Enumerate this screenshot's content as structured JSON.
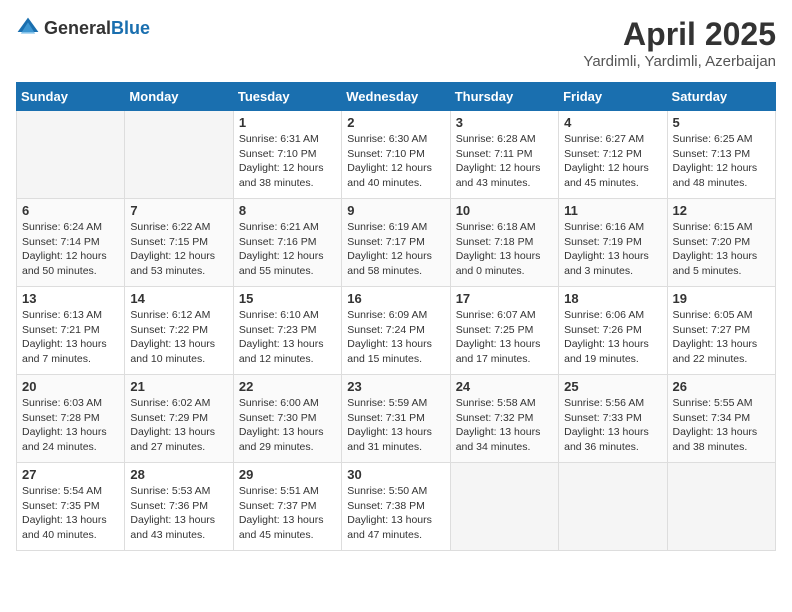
{
  "header": {
    "logo_general": "General",
    "logo_blue": "Blue",
    "month": "April 2025",
    "location": "Yardimli, Yardimli, Azerbaijan"
  },
  "days_of_week": [
    "Sunday",
    "Monday",
    "Tuesday",
    "Wednesday",
    "Thursday",
    "Friday",
    "Saturday"
  ],
  "weeks": [
    [
      {
        "day": "",
        "sunrise": "",
        "sunset": "",
        "daylight": ""
      },
      {
        "day": "",
        "sunrise": "",
        "sunset": "",
        "daylight": ""
      },
      {
        "day": "1",
        "sunrise": "Sunrise: 6:31 AM",
        "sunset": "Sunset: 7:10 PM",
        "daylight": "Daylight: 12 hours and 38 minutes."
      },
      {
        "day": "2",
        "sunrise": "Sunrise: 6:30 AM",
        "sunset": "Sunset: 7:10 PM",
        "daylight": "Daylight: 12 hours and 40 minutes."
      },
      {
        "day": "3",
        "sunrise": "Sunrise: 6:28 AM",
        "sunset": "Sunset: 7:11 PM",
        "daylight": "Daylight: 12 hours and 43 minutes."
      },
      {
        "day": "4",
        "sunrise": "Sunrise: 6:27 AM",
        "sunset": "Sunset: 7:12 PM",
        "daylight": "Daylight: 12 hours and 45 minutes."
      },
      {
        "day": "5",
        "sunrise": "Sunrise: 6:25 AM",
        "sunset": "Sunset: 7:13 PM",
        "daylight": "Daylight: 12 hours and 48 minutes."
      }
    ],
    [
      {
        "day": "6",
        "sunrise": "Sunrise: 6:24 AM",
        "sunset": "Sunset: 7:14 PM",
        "daylight": "Daylight: 12 hours and 50 minutes."
      },
      {
        "day": "7",
        "sunrise": "Sunrise: 6:22 AM",
        "sunset": "Sunset: 7:15 PM",
        "daylight": "Daylight: 12 hours and 53 minutes."
      },
      {
        "day": "8",
        "sunrise": "Sunrise: 6:21 AM",
        "sunset": "Sunset: 7:16 PM",
        "daylight": "Daylight: 12 hours and 55 minutes."
      },
      {
        "day": "9",
        "sunrise": "Sunrise: 6:19 AM",
        "sunset": "Sunset: 7:17 PM",
        "daylight": "Daylight: 12 hours and 58 minutes."
      },
      {
        "day": "10",
        "sunrise": "Sunrise: 6:18 AM",
        "sunset": "Sunset: 7:18 PM",
        "daylight": "Daylight: 13 hours and 0 minutes."
      },
      {
        "day": "11",
        "sunrise": "Sunrise: 6:16 AM",
        "sunset": "Sunset: 7:19 PM",
        "daylight": "Daylight: 13 hours and 3 minutes."
      },
      {
        "day": "12",
        "sunrise": "Sunrise: 6:15 AM",
        "sunset": "Sunset: 7:20 PM",
        "daylight": "Daylight: 13 hours and 5 minutes."
      }
    ],
    [
      {
        "day": "13",
        "sunrise": "Sunrise: 6:13 AM",
        "sunset": "Sunset: 7:21 PM",
        "daylight": "Daylight: 13 hours and 7 minutes."
      },
      {
        "day": "14",
        "sunrise": "Sunrise: 6:12 AM",
        "sunset": "Sunset: 7:22 PM",
        "daylight": "Daylight: 13 hours and 10 minutes."
      },
      {
        "day": "15",
        "sunrise": "Sunrise: 6:10 AM",
        "sunset": "Sunset: 7:23 PM",
        "daylight": "Daylight: 13 hours and 12 minutes."
      },
      {
        "day": "16",
        "sunrise": "Sunrise: 6:09 AM",
        "sunset": "Sunset: 7:24 PM",
        "daylight": "Daylight: 13 hours and 15 minutes."
      },
      {
        "day": "17",
        "sunrise": "Sunrise: 6:07 AM",
        "sunset": "Sunset: 7:25 PM",
        "daylight": "Daylight: 13 hours and 17 minutes."
      },
      {
        "day": "18",
        "sunrise": "Sunrise: 6:06 AM",
        "sunset": "Sunset: 7:26 PM",
        "daylight": "Daylight: 13 hours and 19 minutes."
      },
      {
        "day": "19",
        "sunrise": "Sunrise: 6:05 AM",
        "sunset": "Sunset: 7:27 PM",
        "daylight": "Daylight: 13 hours and 22 minutes."
      }
    ],
    [
      {
        "day": "20",
        "sunrise": "Sunrise: 6:03 AM",
        "sunset": "Sunset: 7:28 PM",
        "daylight": "Daylight: 13 hours and 24 minutes."
      },
      {
        "day": "21",
        "sunrise": "Sunrise: 6:02 AM",
        "sunset": "Sunset: 7:29 PM",
        "daylight": "Daylight: 13 hours and 27 minutes."
      },
      {
        "day": "22",
        "sunrise": "Sunrise: 6:00 AM",
        "sunset": "Sunset: 7:30 PM",
        "daylight": "Daylight: 13 hours and 29 minutes."
      },
      {
        "day": "23",
        "sunrise": "Sunrise: 5:59 AM",
        "sunset": "Sunset: 7:31 PM",
        "daylight": "Daylight: 13 hours and 31 minutes."
      },
      {
        "day": "24",
        "sunrise": "Sunrise: 5:58 AM",
        "sunset": "Sunset: 7:32 PM",
        "daylight": "Daylight: 13 hours and 34 minutes."
      },
      {
        "day": "25",
        "sunrise": "Sunrise: 5:56 AM",
        "sunset": "Sunset: 7:33 PM",
        "daylight": "Daylight: 13 hours and 36 minutes."
      },
      {
        "day": "26",
        "sunrise": "Sunrise: 5:55 AM",
        "sunset": "Sunset: 7:34 PM",
        "daylight": "Daylight: 13 hours and 38 minutes."
      }
    ],
    [
      {
        "day": "27",
        "sunrise": "Sunrise: 5:54 AM",
        "sunset": "Sunset: 7:35 PM",
        "daylight": "Daylight: 13 hours and 40 minutes."
      },
      {
        "day": "28",
        "sunrise": "Sunrise: 5:53 AM",
        "sunset": "Sunset: 7:36 PM",
        "daylight": "Daylight: 13 hours and 43 minutes."
      },
      {
        "day": "29",
        "sunrise": "Sunrise: 5:51 AM",
        "sunset": "Sunset: 7:37 PM",
        "daylight": "Daylight: 13 hours and 45 minutes."
      },
      {
        "day": "30",
        "sunrise": "Sunrise: 5:50 AM",
        "sunset": "Sunset: 7:38 PM",
        "daylight": "Daylight: 13 hours and 47 minutes."
      },
      {
        "day": "",
        "sunrise": "",
        "sunset": "",
        "daylight": ""
      },
      {
        "day": "",
        "sunrise": "",
        "sunset": "",
        "daylight": ""
      },
      {
        "day": "",
        "sunrise": "",
        "sunset": "",
        "daylight": ""
      }
    ]
  ]
}
